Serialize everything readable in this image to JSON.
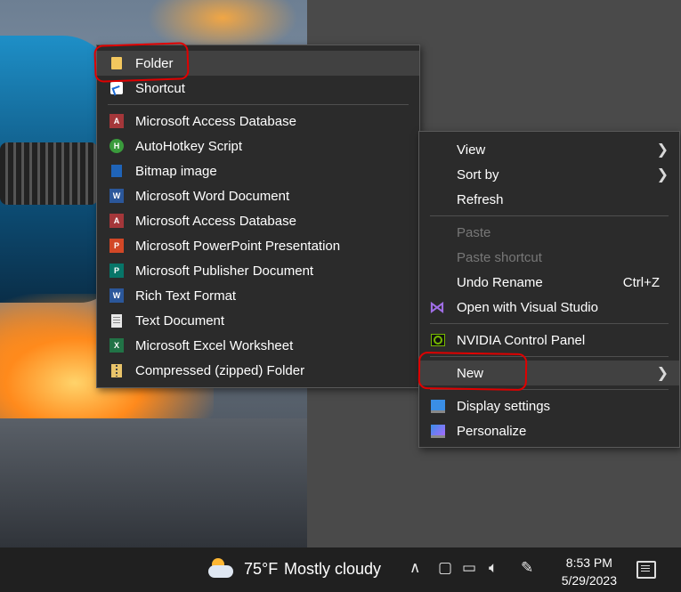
{
  "new_submenu": {
    "items": [
      {
        "label": "Folder",
        "icon": "folder-icon"
      },
      {
        "label": "Shortcut",
        "icon": "shortcut-icon"
      },
      {
        "label": "Microsoft Access Database",
        "icon": "access-icon"
      },
      {
        "label": "AutoHotkey Script",
        "icon": "autohotkey-icon"
      },
      {
        "label": "Bitmap image",
        "icon": "bitmap-icon"
      },
      {
        "label": "Microsoft Word Document",
        "icon": "word-icon"
      },
      {
        "label": "Microsoft Access Database",
        "icon": "access-icon"
      },
      {
        "label": "Microsoft PowerPoint Presentation",
        "icon": "powerpoint-icon"
      },
      {
        "label": "Microsoft Publisher Document",
        "icon": "publisher-icon"
      },
      {
        "label": "Rich Text Format",
        "icon": "rtf-icon"
      },
      {
        "label": "Text Document",
        "icon": "text-document-icon"
      },
      {
        "label": "Microsoft Excel Worksheet",
        "icon": "excel-icon"
      },
      {
        "label": "Compressed (zipped) Folder",
        "icon": "zip-folder-icon"
      }
    ]
  },
  "context_menu": {
    "view": "View",
    "sort_by": "Sort by",
    "refresh": "Refresh",
    "paste": "Paste",
    "paste_shortcut": "Paste shortcut",
    "undo_rename": "Undo Rename",
    "undo_shortcut_key": "Ctrl+Z",
    "open_visual_studio": "Open with Visual Studio",
    "nvidia": "NVIDIA Control Panel",
    "new": "New",
    "display_settings": "Display settings",
    "personalize": "Personalize"
  },
  "taskbar": {
    "temperature": "75°F",
    "weather": "Mostly cloudy",
    "time": "8:53 PM",
    "date": "5/29/2023"
  },
  "colors": {
    "menu_bg": "#2b2b2b",
    "highlight": "#414141",
    "annotation": "#e00000"
  }
}
